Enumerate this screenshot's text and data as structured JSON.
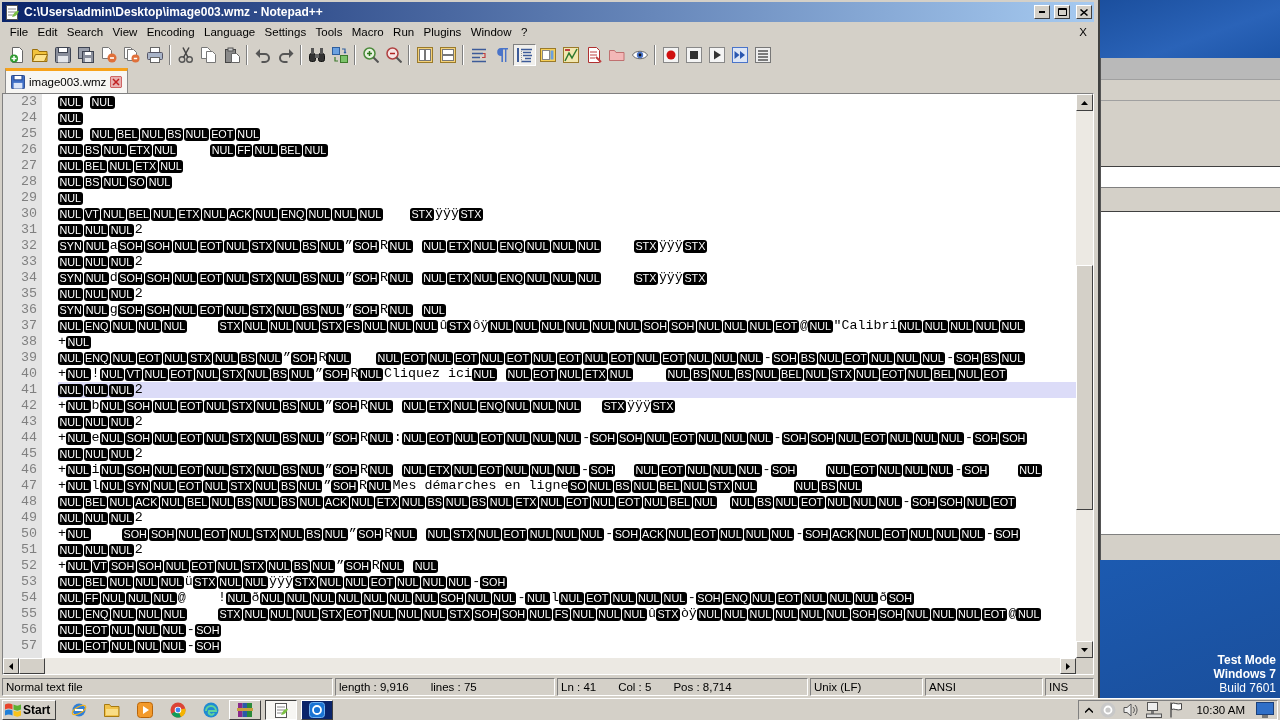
{
  "window": {
    "title": "C:\\Users\\admin\\Desktop\\image003.wmz - Notepad++"
  },
  "menu": {
    "items": [
      "File",
      "Edit",
      "Search",
      "View",
      "Encoding",
      "Language",
      "Settings",
      "Tools",
      "Macro",
      "Run",
      "Plugins",
      "Window",
      "?"
    ],
    "close_label": "X"
  },
  "toolbar": [
    {
      "pressed": false
    },
    {
      "pressed": false
    },
    {
      "pressed": false
    },
    {
      "pressed": false
    },
    {
      "pressed": false
    },
    {
      "pressed": false
    },
    {
      "pressed": false
    },
    {
      "pressed": false
    },
    {
      "pressed": false
    },
    {
      "pressed": false
    },
    {
      "pressed": false
    },
    {
      "pressed": false
    },
    {
      "pressed": false
    },
    {
      "pressed": false
    },
    {
      "pressed": false
    },
    {
      "pressed": false
    },
    {
      "pressed": false
    },
    {
      "pressed": false
    },
    {
      "pressed": false
    },
    {
      "pressed": false
    },
    {
      "pressed": true
    },
    {
      "pressed": false
    },
    {
      "pressed": false
    },
    {
      "pressed": false
    },
    {
      "pressed": false
    },
    {
      "pressed": false
    },
    {
      "pressed": false
    },
    {
      "pressed": false
    },
    {
      "pressed": false
    },
    {
      "pressed": false
    },
    {
      "pressed": false
    }
  ],
  "tabs": [
    {
      "label": "image003.wmz",
      "selected": true
    }
  ],
  "editor": {
    "lines": [
      {
        "number": "23",
        "current": false,
        "segments": [
          {
            "kind": "ctrl",
            "items": [
              "NUL"
            ]
          },
          {
            "kind": "tab"
          },
          {
            "kind": "ctrl",
            "items": [
              "NUL"
            ]
          }
        ]
      },
      {
        "number": "24",
        "current": false,
        "segments": [
          {
            "kind": "ctrl",
            "items": [
              "NUL"
            ]
          }
        ]
      },
      {
        "number": "25",
        "current": false,
        "segments": [
          {
            "kind": "ctrl",
            "items": [
              "NUL"
            ]
          },
          {
            "kind": "tab"
          },
          {
            "kind": "ctrl",
            "items": [
              "NUL",
              "BEL",
              "NUL",
              "BS",
              "NUL",
              "EOT",
              "NUL"
            ]
          }
        ]
      },
      {
        "number": "26",
        "current": false,
        "segments": [
          {
            "kind": "ctrl",
            "items": [
              "NUL",
              "BS",
              "NUL",
              "ETX",
              "NUL"
            ]
          },
          {
            "kind": "space"
          },
          {
            "kind": "space"
          },
          {
            "kind": "space"
          },
          {
            "kind": "space"
          },
          {
            "kind": "ctrl",
            "items": [
              "NUL",
              "FF",
              "NUL",
              "BEL",
              "NUL"
            ]
          }
        ]
      },
      {
        "number": "27",
        "current": false,
        "segments": [
          {
            "kind": "ctrl",
            "items": [
              "NUL",
              "BEL",
              "NUL",
              "ETX",
              "NUL"
            ]
          }
        ]
      },
      {
        "number": "28",
        "current": false,
        "segments": [
          {
            "kind": "ctrl",
            "items": [
              "NUL",
              "BS",
              "NUL",
              "SO",
              "NUL"
            ]
          }
        ]
      },
      {
        "number": "29",
        "current": false,
        "segments": [
          {
            "kind": "ctrl",
            "items": [
              "NUL"
            ]
          }
        ]
      },
      {
        "number": "30",
        "current": false,
        "segments": [
          {
            "kind": "ctrl",
            "items": [
              "NUL",
              "VT",
              "NUL",
              "BEL",
              "NUL",
              "ETX",
              "NUL",
              "ACK",
              "NUL",
              "ENQ",
              "NUL",
              "NUL",
              "NUL"
            ]
          },
          {
            "kind": "tab"
          },
          {
            "kind": "ctrl",
            "items": [
              "STX"
            ]
          },
          {
            "kind": "text",
            "text": "ÿÿÿ"
          },
          {
            "kind": "ctrl",
            "items": [
              "STX"
            ]
          }
        ]
      },
      {
        "number": "31",
        "current": false,
        "segments": [
          {
            "kind": "ctrl",
            "items": [
              "NUL",
              "NUL",
              "NUL"
            ]
          },
          {
            "kind": "text",
            "text": "2"
          }
        ]
      },
      {
        "number": "32",
        "current": false,
        "segments": [
          {
            "kind": "ctrl",
            "items": [
              "SYN",
              "NUL"
            ]
          },
          {
            "kind": "text",
            "text": "a"
          },
          {
            "kind": "ctrl",
            "items": [
              "SOH",
              "SOH",
              "NUL",
              "EOT",
              "NUL",
              "STX",
              "NUL",
              "BS",
              "NUL"
            ]
          },
          {
            "kind": "text",
            "text": "”"
          },
          {
            "kind": "ctrl",
            "items": [
              "SOH"
            ]
          },
          {
            "kind": "text",
            "text": "R"
          },
          {
            "kind": "ctrl",
            "items": [
              "NUL"
            ]
          },
          {
            "kind": "space"
          },
          {
            "kind": "ctrl",
            "items": [
              "NUL",
              "ETX",
              "NUL",
              "ENQ",
              "NUL",
              "NUL",
              "NUL"
            ]
          },
          {
            "kind": "tab"
          },
          {
            "kind": "ctrl",
            "items": [
              "STX"
            ]
          },
          {
            "kind": "text",
            "text": "ÿÿÿ"
          },
          {
            "kind": "ctrl",
            "items": [
              "STX"
            ]
          }
        ]
      },
      {
        "number": "33",
        "current": false,
        "segments": [
          {
            "kind": "ctrl",
            "items": [
              "NUL",
              "NUL",
              "NUL"
            ]
          },
          {
            "kind": "text",
            "text": "2"
          }
        ]
      },
      {
        "number": "34",
        "current": false,
        "segments": [
          {
            "kind": "ctrl",
            "items": [
              "SYN",
              "NUL"
            ]
          },
          {
            "kind": "text",
            "text": "d"
          },
          {
            "kind": "ctrl",
            "items": [
              "SOH",
              "SOH",
              "NUL",
              "EOT",
              "NUL",
              "STX",
              "NUL",
              "BS",
              "NUL"
            ]
          },
          {
            "kind": "text",
            "text": "”"
          },
          {
            "kind": "ctrl",
            "items": [
              "SOH"
            ]
          },
          {
            "kind": "text",
            "text": "R"
          },
          {
            "kind": "ctrl",
            "items": [
              "NUL"
            ]
          },
          {
            "kind": "space"
          },
          {
            "kind": "ctrl",
            "items": [
              "NUL",
              "ETX",
              "NUL",
              "ENQ",
              "NUL",
              "NUL",
              "NUL"
            ]
          },
          {
            "kind": "tab"
          },
          {
            "kind": "ctrl",
            "items": [
              "STX"
            ]
          },
          {
            "kind": "text",
            "text": "ÿÿÿ"
          },
          {
            "kind": "ctrl",
            "items": [
              "STX"
            ]
          }
        ]
      },
      {
        "number": "35",
        "current": false,
        "segments": [
          {
            "kind": "ctrl",
            "items": [
              "NUL",
              "NUL",
              "NUL"
            ]
          },
          {
            "kind": "text",
            "text": "2"
          }
        ]
      },
      {
        "number": "36",
        "current": false,
        "segments": [
          {
            "kind": "ctrl",
            "items": [
              "SYN",
              "NUL"
            ]
          },
          {
            "kind": "text",
            "text": "g"
          },
          {
            "kind": "ctrl",
            "items": [
              "SOH",
              "SOH",
              "NUL",
              "EOT",
              "NUL",
              "STX",
              "NUL",
              "BS",
              "NUL"
            ]
          },
          {
            "kind": "text",
            "text": "”"
          },
          {
            "kind": "ctrl",
            "items": [
              "SOH"
            ]
          },
          {
            "kind": "text",
            "text": "R"
          },
          {
            "kind": "ctrl",
            "items": [
              "NUL"
            ]
          },
          {
            "kind": "space"
          },
          {
            "kind": "ctrl",
            "items": [
              "NUL"
            ]
          }
        ]
      },
      {
        "number": "37",
        "current": false,
        "segments": [
          {
            "kind": "ctrl",
            "items": [
              "NUL",
              "ENQ",
              "NUL",
              "NUL",
              "NUL"
            ]
          },
          {
            "kind": "tab"
          },
          {
            "kind": "ctrl",
            "items": [
              "STX",
              "NUL",
              "NUL",
              "NUL",
              "STX",
              "FS",
              "NUL",
              "NUL",
              "NUL"
            ]
          },
          {
            "kind": "text",
            "text": "û"
          },
          {
            "kind": "ctrl",
            "items": [
              "STX"
            ]
          },
          {
            "kind": "text",
            "text": "ôÿ"
          },
          {
            "kind": "ctrl",
            "items": [
              "NUL",
              "NUL",
              "NUL",
              "NUL",
              "NUL",
              "NUL",
              "SOH",
              "SOH",
              "NUL",
              "NUL",
              "NUL",
              "EOT"
            ]
          },
          {
            "kind": "text",
            "text": "@"
          },
          {
            "kind": "ctrl",
            "items": [
              "NUL"
            ]
          },
          {
            "kind": "text",
            "text": "\"Calibri"
          },
          {
            "kind": "ctrl",
            "items": [
              "NUL",
              "NUL",
              "NUL",
              "NUL",
              "NUL"
            ]
          }
        ]
      },
      {
        "number": "38",
        "current": false,
        "segments": [
          {
            "kind": "text",
            "text": "+"
          },
          {
            "kind": "ctrl",
            "items": [
              "NUL"
            ]
          }
        ]
      },
      {
        "number": "39",
        "current": false,
        "segments": [
          {
            "kind": "ctrl",
            "items": [
              "NUL",
              "ENQ",
              "NUL",
              "EOT",
              "NUL",
              "STX",
              "NUL",
              "BS",
              "NUL"
            ]
          },
          {
            "kind": "text",
            "text": "”"
          },
          {
            "kind": "ctrl",
            "items": [
              "SOH"
            ]
          },
          {
            "kind": "text",
            "text": "R"
          },
          {
            "kind": "ctrl",
            "items": [
              "NUL"
            ]
          },
          {
            "kind": "space"
          },
          {
            "kind": "space"
          },
          {
            "kind": "space"
          },
          {
            "kind": "ctrl",
            "items": [
              "NUL",
              "EOT",
              "NUL",
              "EOT",
              "NUL",
              "EOT",
              "NUL",
              "EOT",
              "NUL",
              "EOT",
              "NUL",
              "EOT",
              "NUL",
              "NUL",
              "NUL"
            ]
          },
          {
            "kind": "text",
            "text": "-"
          },
          {
            "kind": "ctrl",
            "items": [
              "SOH",
              "BS",
              "NUL",
              "EOT",
              "NUL",
              "NUL",
              "NUL"
            ]
          },
          {
            "kind": "text",
            "text": "-"
          },
          {
            "kind": "ctrl",
            "items": [
              "SOH",
              "BS",
              "NUL"
            ]
          }
        ]
      },
      {
        "number": "40",
        "current": false,
        "segments": [
          {
            "kind": "text",
            "text": "+"
          },
          {
            "kind": "ctrl",
            "items": [
              "NUL"
            ]
          },
          {
            "kind": "text",
            "text": "!"
          },
          {
            "kind": "ctrl",
            "items": [
              "NUL",
              "VT",
              "NUL",
              "EOT",
              "NUL",
              "STX",
              "NUL",
              "BS",
              "NUL"
            ]
          },
          {
            "kind": "text",
            "text": "”"
          },
          {
            "kind": "ctrl",
            "items": [
              "SOH"
            ]
          },
          {
            "kind": "text",
            "text": "R"
          },
          {
            "kind": "ctrl",
            "items": [
              "NUL"
            ]
          },
          {
            "kind": "text",
            "text": "Cliquez ici"
          },
          {
            "kind": "ctrl",
            "items": [
              "NUL"
            ]
          },
          {
            "kind": "tab"
          },
          {
            "kind": "ctrl",
            "items": [
              "NUL",
              "EOT",
              "NUL",
              "ETX",
              "NUL"
            ]
          },
          {
            "kind": "tab"
          },
          {
            "kind": "ctrl",
            "items": [
              "NUL",
              "BS",
              "NUL",
              "BS",
              "NUL",
              "BEL",
              "NUL",
              "STX",
              "NUL",
              "EOT",
              "NUL",
              "BEL",
              "NUL",
              "EOT"
            ]
          }
        ]
      },
      {
        "number": "41",
        "current": true,
        "segments": [
          {
            "kind": "ctrl",
            "items": [
              "NUL",
              "NUL",
              "NUL"
            ]
          },
          {
            "kind": "text",
            "text": "2"
          }
        ]
      },
      {
        "number": "42",
        "current": false,
        "segments": [
          {
            "kind": "text",
            "text": "+"
          },
          {
            "kind": "ctrl",
            "items": [
              "NUL"
            ]
          },
          {
            "kind": "text",
            "text": "b"
          },
          {
            "kind": "ctrl",
            "items": [
              "NUL",
              "SOH",
              "NUL",
              "EOT",
              "NUL",
              "STX",
              "NUL",
              "BS",
              "NUL"
            ]
          },
          {
            "kind": "text",
            "text": "”"
          },
          {
            "kind": "ctrl",
            "items": [
              "SOH"
            ]
          },
          {
            "kind": "text",
            "text": "R"
          },
          {
            "kind": "ctrl",
            "items": [
              "NUL"
            ]
          },
          {
            "kind": "space"
          },
          {
            "kind": "ctrl",
            "items": [
              "NUL",
              "ETX",
              "NUL",
              "ENQ",
              "NUL",
              "NUL",
              "NUL"
            ]
          },
          {
            "kind": "tab"
          },
          {
            "kind": "ctrl",
            "items": [
              "STX"
            ]
          },
          {
            "kind": "text",
            "text": "ÿÿÿ"
          },
          {
            "kind": "ctrl",
            "items": [
              "STX"
            ]
          }
        ]
      },
      {
        "number": "43",
        "current": false,
        "segments": [
          {
            "kind": "ctrl",
            "items": [
              "NUL",
              "NUL",
              "NUL"
            ]
          },
          {
            "kind": "text",
            "text": "2"
          }
        ]
      },
      {
        "number": "44",
        "current": false,
        "segments": [
          {
            "kind": "text",
            "text": "+"
          },
          {
            "kind": "ctrl",
            "items": [
              "NUL"
            ]
          },
          {
            "kind": "text",
            "text": "e"
          },
          {
            "kind": "ctrl",
            "items": [
              "NUL",
              "SOH",
              "NUL",
              "EOT",
              "NUL",
              "STX",
              "NUL",
              "BS",
              "NUL"
            ]
          },
          {
            "kind": "text",
            "text": "”"
          },
          {
            "kind": "ctrl",
            "items": [
              "SOH"
            ]
          },
          {
            "kind": "text",
            "text": "R"
          },
          {
            "kind": "ctrl",
            "items": [
              "NUL"
            ]
          },
          {
            "kind": "text",
            "text": ":"
          },
          {
            "kind": "ctrl",
            "items": [
              "NUL",
              "EOT",
              "NUL",
              "EOT",
              "NUL",
              "NUL",
              "NUL"
            ]
          },
          {
            "kind": "text",
            "text": "-"
          },
          {
            "kind": "ctrl",
            "items": [
              "SOH",
              "SOH",
              "NUL",
              "EOT",
              "NUL",
              "NUL",
              "NUL"
            ]
          },
          {
            "kind": "text",
            "text": "-"
          },
          {
            "kind": "ctrl",
            "items": [
              "SOH",
              "SOH",
              "NUL",
              "EOT",
              "NUL",
              "NUL",
              "NUL"
            ]
          },
          {
            "kind": "text",
            "text": "-"
          },
          {
            "kind": "ctrl",
            "items": [
              "SOH",
              "SOH"
            ]
          }
        ]
      },
      {
        "number": "45",
        "current": false,
        "segments": [
          {
            "kind": "ctrl",
            "items": [
              "NUL",
              "NUL",
              "NUL"
            ]
          },
          {
            "kind": "text",
            "text": "2"
          }
        ]
      },
      {
        "number": "46",
        "current": false,
        "segments": [
          {
            "kind": "text",
            "text": "+"
          },
          {
            "kind": "ctrl",
            "items": [
              "NUL"
            ]
          },
          {
            "kind": "text",
            "text": "i"
          },
          {
            "kind": "ctrl",
            "items": [
              "NUL",
              "SOH",
              "NUL",
              "EOT",
              "NUL",
              "STX",
              "NUL",
              "BS",
              "NUL"
            ]
          },
          {
            "kind": "text",
            "text": "”"
          },
          {
            "kind": "ctrl",
            "items": [
              "SOH"
            ]
          },
          {
            "kind": "text",
            "text": "R"
          },
          {
            "kind": "ctrl",
            "items": [
              "NUL"
            ]
          },
          {
            "kind": "space"
          },
          {
            "kind": "ctrl",
            "items": [
              "NUL",
              "ETX",
              "NUL",
              "EOT",
              "NUL",
              "NUL",
              "NUL"
            ]
          },
          {
            "kind": "text",
            "text": "-"
          },
          {
            "kind": "ctrl",
            "items": [
              "SOH"
            ]
          },
          {
            "kind": "tab"
          },
          {
            "kind": "ctrl",
            "items": [
              "NUL",
              "EOT",
              "NUL",
              "NUL",
              "NUL"
            ]
          },
          {
            "kind": "text",
            "text": "-"
          },
          {
            "kind": "ctrl",
            "items": [
              "SOH"
            ]
          },
          {
            "kind": "tab"
          },
          {
            "kind": "ctrl",
            "items": [
              "NUL",
              "EOT",
              "NUL",
              "NUL",
              "NUL"
            ]
          },
          {
            "kind": "text",
            "text": "-"
          },
          {
            "kind": "ctrl",
            "items": [
              "SOH"
            ]
          },
          {
            "kind": "tab"
          },
          {
            "kind": "ctrl",
            "items": [
              "NUL"
            ]
          }
        ]
      },
      {
        "number": "47",
        "current": false,
        "segments": [
          {
            "kind": "text",
            "text": "+"
          },
          {
            "kind": "ctrl",
            "items": [
              "NUL"
            ]
          },
          {
            "kind": "text",
            "text": "l"
          },
          {
            "kind": "ctrl",
            "items": [
              "NUL",
              "SYN",
              "NUL",
              "EOT",
              "NUL",
              "STX",
              "NUL",
              "BS",
              "NUL"
            ]
          },
          {
            "kind": "text",
            "text": "”"
          },
          {
            "kind": "ctrl",
            "items": [
              "SOH"
            ]
          },
          {
            "kind": "text",
            "text": "R"
          },
          {
            "kind": "ctrl",
            "items": [
              "NUL"
            ]
          },
          {
            "kind": "text",
            "text": "Mes démarches en ligne"
          },
          {
            "kind": "ctrl",
            "items": [
              "SO",
              "NUL",
              "BS",
              "NUL",
              "BEL",
              "NUL",
              "STX",
              "NUL"
            ]
          },
          {
            "kind": "tab"
          },
          {
            "kind": "ctrl",
            "items": [
              "NUL",
              "BS",
              "NUL"
            ]
          }
        ]
      },
      {
        "number": "48",
        "current": false,
        "segments": [
          {
            "kind": "ctrl",
            "items": [
              "NUL",
              "BEL",
              "NUL",
              "ACK",
              "NUL",
              "BEL",
              "NUL",
              "BS",
              "NUL",
              "BS",
              "NUL",
              "ACK",
              "NUL",
              "ETX",
              "NUL",
              "BS",
              "NUL",
              "BS",
              "NUL",
              "ETX",
              "NUL",
              "EOT",
              "NUL",
              "EOT",
              "NUL",
              "BEL",
              "NUL"
            ]
          },
          {
            "kind": "tab"
          },
          {
            "kind": "ctrl",
            "items": [
              "NUL",
              "BS",
              "NUL",
              "EOT",
              "NUL",
              "NUL",
              "NUL"
            ]
          },
          {
            "kind": "text",
            "text": "-"
          },
          {
            "kind": "ctrl",
            "items": [
              "SOH",
              "SOH",
              "NUL",
              "EOT"
            ]
          }
        ]
      },
      {
        "number": "49",
        "current": false,
        "segments": [
          {
            "kind": "ctrl",
            "items": [
              "NUL",
              "NUL",
              "NUL"
            ]
          },
          {
            "kind": "text",
            "text": "2"
          }
        ]
      },
      {
        "number": "50",
        "current": false,
        "segments": [
          {
            "kind": "text",
            "text": "+"
          },
          {
            "kind": "ctrl",
            "items": [
              "NUL"
            ]
          },
          {
            "kind": "tab"
          },
          {
            "kind": "ctrl",
            "items": [
              "SOH",
              "SOH",
              "NUL",
              "EOT",
              "NUL",
              "STX",
              "NUL",
              "BS",
              "NUL"
            ]
          },
          {
            "kind": "text",
            "text": "”"
          },
          {
            "kind": "ctrl",
            "items": [
              "SOH"
            ]
          },
          {
            "kind": "text",
            "text": "R"
          },
          {
            "kind": "ctrl",
            "items": [
              "NUL"
            ]
          },
          {
            "kind": "space"
          },
          {
            "kind": "ctrl",
            "items": [
              "NUL",
              "STX",
              "NUL",
              "EOT",
              "NUL",
              "NUL",
              "NUL"
            ]
          },
          {
            "kind": "text",
            "text": "-"
          },
          {
            "kind": "ctrl",
            "items": [
              "SOH",
              "ACK",
              "NUL",
              "EOT",
              "NUL",
              "NUL",
              "NUL"
            ]
          },
          {
            "kind": "text",
            "text": "-"
          },
          {
            "kind": "ctrl",
            "items": [
              "SOH",
              "ACK",
              "NUL",
              "EOT",
              "NUL",
              "NUL",
              "NUL"
            ]
          },
          {
            "kind": "text",
            "text": "-"
          },
          {
            "kind": "ctrl",
            "items": [
              "SOH"
            ]
          }
        ]
      },
      {
        "number": "51",
        "current": false,
        "segments": [
          {
            "kind": "ctrl",
            "items": [
              "NUL",
              "NUL",
              "NUL"
            ]
          },
          {
            "kind": "text",
            "text": "2"
          }
        ]
      },
      {
        "number": "52",
        "current": false,
        "segments": [
          {
            "kind": "text",
            "text": "+"
          },
          {
            "kind": "ctrl",
            "items": [
              "NUL",
              "VT",
              "SOH",
              "SOH",
              "NUL",
              "EOT",
              "NUL",
              "STX",
              "NUL",
              "BS",
              "NUL"
            ]
          },
          {
            "kind": "text",
            "text": "”"
          },
          {
            "kind": "ctrl",
            "items": [
              "SOH"
            ]
          },
          {
            "kind": "text",
            "text": "R"
          },
          {
            "kind": "ctrl",
            "items": [
              "NUL"
            ]
          },
          {
            "kind": "space"
          },
          {
            "kind": "ctrl",
            "items": [
              "NUL"
            ]
          }
        ]
      },
      {
        "number": "53",
        "current": false,
        "segments": [
          {
            "kind": "ctrl",
            "items": [
              "NUL",
              "BEL",
              "NUL",
              "NUL",
              "NUL"
            ]
          },
          {
            "kind": "text",
            "text": "ü"
          },
          {
            "kind": "ctrl",
            "items": [
              "STX",
              "NUL",
              "NUL"
            ]
          },
          {
            "kind": "text",
            "text": "ÿÿÿ"
          },
          {
            "kind": "ctrl",
            "items": [
              "STX",
              "NUL",
              "NUL",
              "EOT",
              "NUL",
              "NUL",
              "NUL"
            ]
          },
          {
            "kind": "text",
            "text": "-"
          },
          {
            "kind": "ctrl",
            "items": [
              "SOH"
            ]
          }
        ]
      },
      {
        "number": "54",
        "current": false,
        "segments": [
          {
            "kind": "ctrl",
            "items": [
              "NUL",
              "FF",
              "NUL",
              "NUL",
              "NUL"
            ]
          },
          {
            "kind": "text",
            "text": "@"
          },
          {
            "kind": "tab"
          },
          {
            "kind": "text",
            "text": "!"
          },
          {
            "kind": "ctrl",
            "items": [
              "NUL"
            ]
          },
          {
            "kind": "text",
            "text": "ð"
          },
          {
            "kind": "ctrl",
            "items": [
              "NUL",
              "NUL",
              "NUL",
              "NUL",
              "NUL",
              "NUL",
              "NUL",
              "SOH",
              "NUL",
              "NUL"
            ]
          },
          {
            "kind": "text",
            "text": "-"
          },
          {
            "kind": "ctrl",
            "items": [
              "NUL"
            ]
          },
          {
            "kind": "text",
            "text": "l"
          },
          {
            "kind": "ctrl",
            "items": [
              "NUL",
              "EOT",
              "NUL",
              "NUL",
              "NUL"
            ]
          },
          {
            "kind": "text",
            "text": "-"
          },
          {
            "kind": "ctrl",
            "items": [
              "SOH",
              "ENQ",
              "NUL",
              "EOT",
              "NUL",
              "NUL",
              "NUL"
            ]
          },
          {
            "kind": "text",
            "text": "ð"
          },
          {
            "kind": "ctrl",
            "items": [
              "SOH"
            ]
          }
        ]
      },
      {
        "number": "55",
        "current": false,
        "segments": [
          {
            "kind": "ctrl",
            "items": [
              "NUL",
              "ENQ",
              "NUL",
              "NUL",
              "NUL"
            ]
          },
          {
            "kind": "tab"
          },
          {
            "kind": "ctrl",
            "items": [
              "STX",
              "NUL",
              "NUL",
              "NUL",
              "STX",
              "EOT",
              "NUL",
              "NUL",
              "NUL",
              "STX",
              "SOH",
              "SOH",
              "NUL",
              "FS",
              "NUL",
              "NUL",
              "NUL"
            ]
          },
          {
            "kind": "text",
            "text": "û"
          },
          {
            "kind": "ctrl",
            "items": [
              "STX"
            ]
          },
          {
            "kind": "text",
            "text": "òÿ"
          },
          {
            "kind": "ctrl",
            "items": [
              "NUL",
              "NUL",
              "NUL",
              "NUL",
              "NUL",
              "NUL",
              "SOH",
              "SOH",
              "NUL",
              "NUL",
              "NUL",
              "EOT"
            ]
          },
          {
            "kind": "text",
            "text": "@"
          },
          {
            "kind": "ctrl",
            "items": [
              "NUL"
            ]
          }
        ]
      },
      {
        "number": "56",
        "current": false,
        "segments": [
          {
            "kind": "ctrl",
            "items": [
              "NUL",
              "EOT",
              "NUL",
              "NUL",
              "NUL"
            ]
          },
          {
            "kind": "text",
            "text": "-"
          },
          {
            "kind": "ctrl",
            "items": [
              "SOH"
            ]
          }
        ]
      },
      {
        "number": "57",
        "current": false,
        "segments": [
          {
            "kind": "ctrl",
            "items": [
              "NUL",
              "EOT",
              "NUL",
              "NUL",
              "NUL"
            ]
          },
          {
            "kind": "text",
            "text": "-"
          },
          {
            "kind": "ctrl",
            "items": [
              "SOH"
            ]
          }
        ]
      }
    ]
  },
  "status_bar": [
    {
      "items": [
        "Normal text file"
      ]
    },
    {
      "items": [
        "length : 9,916",
        "lines : 75"
      ]
    },
    {
      "items": [
        "Ln : 41",
        "Col : 5",
        "Pos : 8,714"
      ]
    },
    {
      "items": [
        "Unix (LF)"
      ]
    },
    {
      "items": [
        "ANSI"
      ]
    },
    {
      "items": [
        "INS"
      ]
    }
  ],
  "desktop": {
    "notice": [
      "Test Mode",
      "Windows 7",
      "Build 7601"
    ]
  },
  "taskbar": {
    "start": "Start",
    "apps": [
      {
        "kind": "launcher",
        "active": false,
        "highlighted": false
      },
      {
        "kind": "launcher",
        "active": false,
        "highlighted": false
      },
      {
        "kind": "launcher",
        "active": false,
        "highlighted": false
      },
      {
        "kind": "launcher",
        "active": false,
        "highlighted": false
      },
      {
        "kind": "launcher",
        "active": false,
        "highlighted": false
      },
      {
        "kind": "task",
        "active": false,
        "highlighted": false
      },
      {
        "kind": "task",
        "active": true,
        "highlighted": false
      },
      {
        "kind": "task",
        "active": false,
        "highlighted": true
      }
    ],
    "clock": "10:30 AM"
  }
}
